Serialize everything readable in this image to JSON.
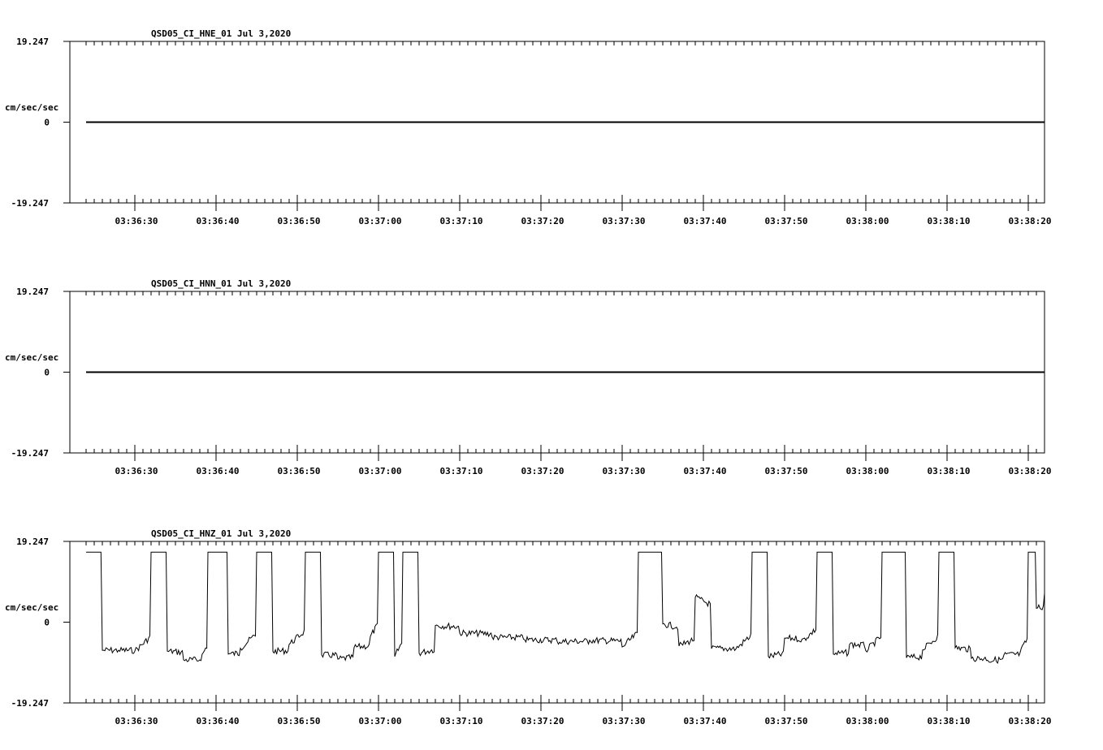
{
  "x_ticks": [
    "03:36:30",
    "03:36:40",
    "03:36:50",
    "03:37:00",
    "03:37:10",
    "03:37:20",
    "03:37:30",
    "03:37:40",
    "03:37:50",
    "03:38:00",
    "03:38:10",
    "03:38:20"
  ],
  "panels": [
    {
      "title": "QSD05_CI_HNE_01  Jul 3,2020",
      "unit": "cm/sec/sec",
      "y_max": "19.247",
      "y_zero": "0",
      "y_min": "-19.247"
    },
    {
      "title": "QSD05_CI_HNN_01  Jul 3,2020",
      "unit": "cm/sec/sec",
      "y_max": "19.247",
      "y_zero": "0",
      "y_min": "-19.247"
    },
    {
      "title": "QSD05_CI_HNZ_01  Jul 3,2020",
      "unit": "cm/sec/sec",
      "y_max": "19.247",
      "y_zero": "0",
      "y_min": "-19.247"
    }
  ],
  "chart_data": [
    {
      "type": "line",
      "title": "QSD05_CI_HNE_01  Jul 3,2020",
      "ylabel": "cm/sec/sec",
      "ylim": [
        -19.247,
        19.247
      ],
      "xlim": [
        "03:36:22",
        "03:38:22"
      ],
      "series": [
        {
          "x": [
            "03:36:24",
            "03:38:22"
          ],
          "values": [
            0,
            0
          ]
        }
      ]
    },
    {
      "type": "line",
      "title": "QSD05_CI_HNN_01  Jul 3,2020",
      "ylabel": "cm/sec/sec",
      "ylim": [
        -19.247,
        19.247
      ],
      "xlim": [
        "03:36:22",
        "03:38:22"
      ],
      "series": [
        {
          "x": [
            "03:36:24",
            "03:38:22"
          ],
          "values": [
            0,
            0
          ]
        }
      ]
    },
    {
      "type": "line",
      "title": "QSD05_CI_HNZ_01  Jul 3,2020",
      "ylabel": "cm/sec/sec",
      "ylim": [
        -19.247,
        19.247
      ],
      "xlim": [
        "03:36:22",
        "03:38:22"
      ],
      "series": [
        {
          "x": [
            "03:36:24",
            "03:36:25.5",
            "03:36:26",
            "03:36:28",
            "03:36:30",
            "03:36:32",
            "03:36:34",
            "03:36:36",
            "03:36:38",
            "03:36:39",
            "03:36:41.5",
            "03:36:43",
            "03:36:45",
            "03:36:47",
            "03:36:49",
            "03:36:51",
            "03:36:53",
            "03:36:55",
            "03:36:57",
            "03:36:59",
            "03:37:00",
            "03:37:02",
            "03:37:03",
            "03:37:05",
            "03:37:07",
            "03:37:10",
            "03:37:14",
            "03:37:18",
            "03:37:22",
            "03:37:26",
            "03:37:30",
            "03:37:32",
            "03:37:35",
            "03:37:37",
            "03:37:39",
            "03:37:41",
            "03:37:44",
            "03:37:46",
            "03:37:48",
            "03:37:50",
            "03:37:52",
            "03:37:54",
            "03:37:56",
            "03:37:58",
            "03:38:00",
            "03:38:02",
            "03:38:05",
            "03:38:07",
            "03:38:09",
            "03:38:11",
            "03:38:13",
            "03:38:15",
            "03:38:17",
            "03:38:19",
            "03:38:20",
            "03:38:21",
            "03:38:22"
          ],
          "values": [
            16.7,
            16.7,
            -6.7,
            -6.7,
            -6.9,
            16.7,
            -6.9,
            -9.0,
            -9.0,
            16.7,
            -7.6,
            -6.2,
            16.7,
            -7.0,
            -5.3,
            16.7,
            -7.8,
            -8.8,
            -6.0,
            -3.4,
            16.7,
            -8.2,
            16.7,
            -7.4,
            -0.8,
            -2.6,
            -3.6,
            -4.2,
            -4.6,
            -4.3,
            -5.9,
            16.7,
            -0.4,
            -5.7,
            5.9,
            -6.3,
            -6.4,
            16.7,
            -8.2,
            -3.8,
            -4.7,
            16.7,
            -7.6,
            -5.3,
            -6.8,
            16.7,
            -8.5,
            -6.6,
            16.7,
            -6.1,
            -8.6,
            -9.1,
            -7.8,
            -7.2,
            16.7,
            3.3,
            6.9
          ]
        }
      ]
    }
  ]
}
